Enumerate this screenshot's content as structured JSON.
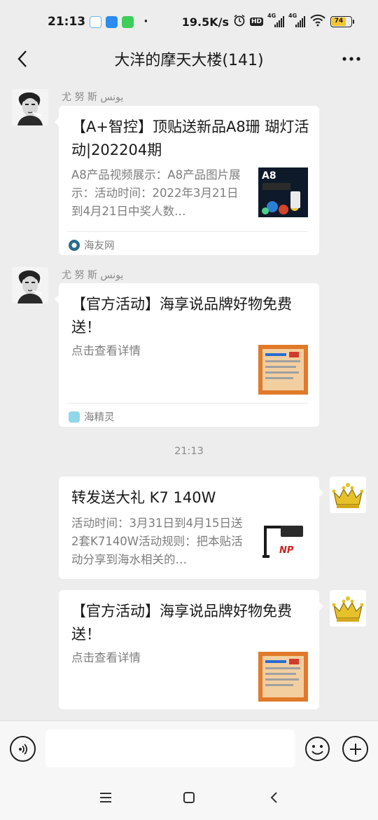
{
  "status_bar": {
    "time": "21:13",
    "dot": "·",
    "net_speed": "19.5K/s",
    "hd": "HD",
    "signal_label": "4G",
    "battery": "74"
  },
  "header": {
    "title": "大洋的摩天大楼(141)"
  },
  "messages": [
    {
      "sender": "尤 努 斯 یونس",
      "title": "【A+智控】顶贴送新品A8珊 瑚灯活动|202204期",
      "desc": "A8产品视频展示：A8产品图片展示：活动时间：2022年3月21日到4月21日中奖人数…",
      "source": "海友网",
      "thumb_text": "A8"
    },
    {
      "sender": "尤 努 斯 یونس",
      "title": "【官方活动】海享说品牌好物免费送！",
      "desc": "点击查看详情",
      "source": "海精灵"
    },
    {
      "time": "21:13"
    },
    {
      "title": "转发送大礼 K7 140W",
      "desc": "活动时间：3月31日到4月15日送2套K7140W活动规则：把本贴活动分享到海水相关的…",
      "thumb_text": "NP"
    },
    {
      "title": "【官方活动】海享说品牌好物免费送！",
      "desc": "点击查看详情"
    }
  ],
  "input": {
    "placeholder": ""
  },
  "icons": {
    "back": "back-arrow-icon",
    "more": "more-dots-icon",
    "voice": "voice-icon",
    "emoji": "emoji-icon",
    "plus": "plus-icon"
  },
  "colors": {
    "background": "#ededed",
    "card": "#ffffff",
    "battery": "#f2c532",
    "sub_text": "#7d7d7d"
  }
}
